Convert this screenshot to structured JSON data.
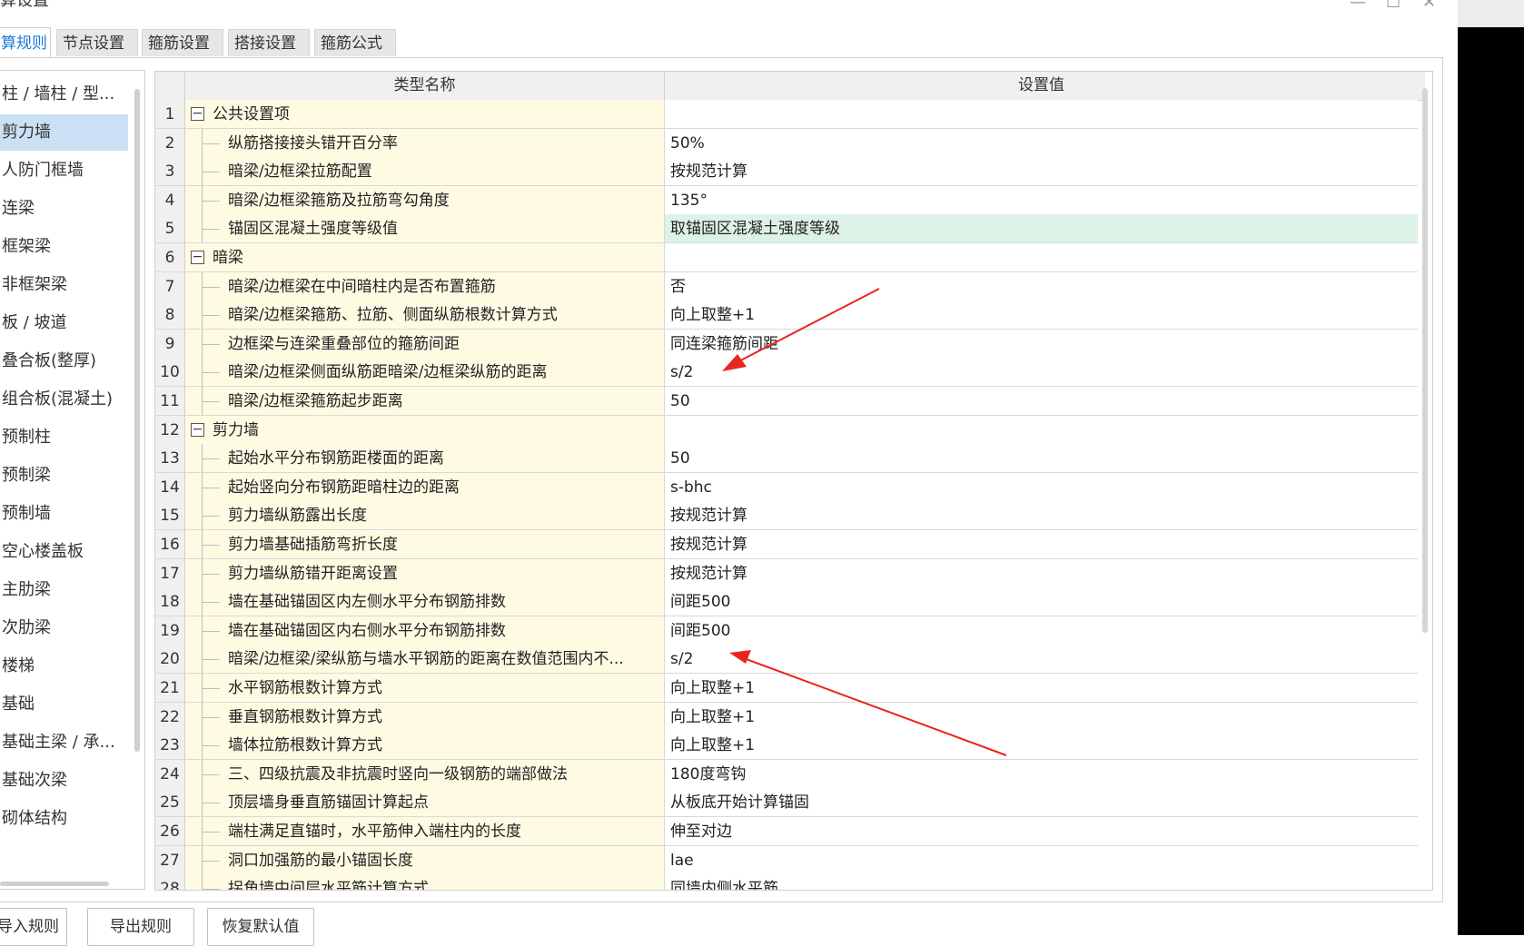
{
  "window": {
    "title": "算设置",
    "controls": [
      "—",
      "☐",
      "✕"
    ]
  },
  "tabs": [
    {
      "label": "算规则",
      "active": true
    },
    {
      "label": "节点设置",
      "active": false
    },
    {
      "label": "箍筋设置",
      "active": false
    },
    {
      "label": "搭接设置",
      "active": false
    },
    {
      "label": "箍筋公式",
      "active": false
    }
  ],
  "sidebar": {
    "items": [
      {
        "label": "柱 / 墙柱 / 型...",
        "selected": false
      },
      {
        "label": "剪力墙",
        "selected": true
      },
      {
        "label": "人防门框墙",
        "selected": false
      },
      {
        "label": "连梁",
        "selected": false
      },
      {
        "label": "框架梁",
        "selected": false
      },
      {
        "label": "非框架梁",
        "selected": false
      },
      {
        "label": "板 / 坡道",
        "selected": false
      },
      {
        "label": "叠合板(整厚)",
        "selected": false
      },
      {
        "label": "组合板(混凝土)",
        "selected": false
      },
      {
        "label": "预制柱",
        "selected": false
      },
      {
        "label": "预制梁",
        "selected": false
      },
      {
        "label": "预制墙",
        "selected": false
      },
      {
        "label": "空心楼盖板",
        "selected": false
      },
      {
        "label": "主肋梁",
        "selected": false
      },
      {
        "label": "次肋梁",
        "selected": false
      },
      {
        "label": "楼梯",
        "selected": false
      },
      {
        "label": "基础",
        "selected": false
      },
      {
        "label": "基础主梁 / 承...",
        "selected": false
      },
      {
        "label": "基础次梁",
        "selected": false
      },
      {
        "label": "砌体结构",
        "selected": false
      }
    ]
  },
  "grid": {
    "headers": {
      "name": "类型名称",
      "value": "设置值"
    },
    "rows": [
      {
        "num": "1",
        "name": "公共设置项",
        "value": "",
        "group": true,
        "toggle": "−"
      },
      {
        "num": "2",
        "name": "纵筋搭接接头错开百分率",
        "value": "50%"
      },
      {
        "num": "3",
        "name": "暗梁/边框梁拉筋配置",
        "value": "按规范计算"
      },
      {
        "num": "4",
        "name": "暗梁/边框梁箍筋及拉筋弯勾角度",
        "value": "135°"
      },
      {
        "num": "5",
        "name": "锚固区混凝土强度等级值",
        "value": "取锚固区混凝土强度等级",
        "highlight": true
      },
      {
        "num": "6",
        "name": "暗梁",
        "value": "",
        "group": true,
        "toggle": "−"
      },
      {
        "num": "7",
        "name": "暗梁/边框梁在中间暗柱内是否布置箍筋",
        "value": "否"
      },
      {
        "num": "8",
        "name": "暗梁/边框梁箍筋、拉筋、侧面纵筋根数计算方式",
        "value": "向上取整+1"
      },
      {
        "num": "9",
        "name": "边框梁与连梁重叠部位的箍筋间距",
        "value": "同连梁箍筋间距"
      },
      {
        "num": "10",
        "name": "暗梁/边框梁侧面纵筋距暗梁/边框梁纵筋的距离",
        "value": "s/2"
      },
      {
        "num": "11",
        "name": "暗梁/边框梁箍筋起步距离",
        "value": "50"
      },
      {
        "num": "12",
        "name": "剪力墙",
        "value": "",
        "group": true,
        "toggle": "−"
      },
      {
        "num": "13",
        "name": "起始水平分布钢筋距楼面的距离",
        "value": "50"
      },
      {
        "num": "14",
        "name": "起始竖向分布钢筋距暗柱边的距离",
        "value": "s-bhc"
      },
      {
        "num": "15",
        "name": "剪力墙纵筋露出长度",
        "value": "按规范计算"
      },
      {
        "num": "16",
        "name": "剪力墙基础插筋弯折长度",
        "value": "按规范计算"
      },
      {
        "num": "17",
        "name": "剪力墙纵筋错开距离设置",
        "value": "按规范计算"
      },
      {
        "num": "18",
        "name": "墙在基础锚固区内左侧水平分布钢筋排数",
        "value": "间距500"
      },
      {
        "num": "19",
        "name": "墙在基础锚固区内右侧水平分布钢筋排数",
        "value": "间距500"
      },
      {
        "num": "20",
        "name": "暗梁/边框梁/梁纵筋与墙水平钢筋的距离在数值范围内不...",
        "value": "s/2"
      },
      {
        "num": "21",
        "name": "水平钢筋根数计算方式",
        "value": "向上取整+1"
      },
      {
        "num": "22",
        "name": "垂直钢筋根数计算方式",
        "value": "向上取整+1"
      },
      {
        "num": "23",
        "name": "墙体拉筋根数计算方式",
        "value": "向上取整+1"
      },
      {
        "num": "24",
        "name": "三、四级抗震及非抗震时竖向一级钢筋的端部做法",
        "value": "180度弯钩"
      },
      {
        "num": "25",
        "name": "顶层墙身垂直筋锚固计算起点",
        "value": "从板底开始计算锚固"
      },
      {
        "num": "26",
        "name": "端柱满足直锚时，水平筋伸入端柱内的长度",
        "value": "伸至对边"
      },
      {
        "num": "27",
        "name": "洞口加强筋的最小锚固长度",
        "value": "lae"
      },
      {
        "num": "28",
        "name": "拐角墙中间层水平筋计算方式",
        "value": "同墙内侧水平筋"
      }
    ]
  },
  "buttons": {
    "import": "导入规则",
    "export": "导出规则",
    "restore": "恢复默认值"
  },
  "annotation_color": "#e8261f"
}
